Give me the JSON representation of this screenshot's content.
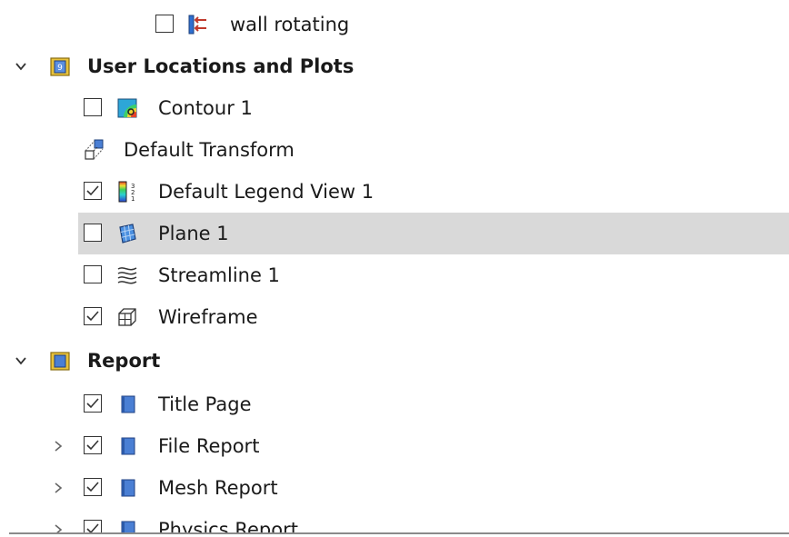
{
  "tree": {
    "rows": [
      {
        "label": "wall rotating",
        "checked": false,
        "icon": "wall-rotating-icon"
      },
      {
        "label": "User Locations and Plots",
        "expanded": true,
        "icon": "folder-icon"
      },
      {
        "label": "Contour 1",
        "checked": false,
        "icon": "contour-icon"
      },
      {
        "label": "Default Transform",
        "icon": "transform-icon"
      },
      {
        "label": "Default Legend View 1",
        "checked": true,
        "icon": "legend-icon"
      },
      {
        "label": "Plane 1",
        "checked": false,
        "selected": true,
        "icon": "plane-icon"
      },
      {
        "label": "Streamline 1",
        "checked": false,
        "icon": "streamline-icon"
      },
      {
        "label": "Wireframe",
        "checked": true,
        "icon": "wireframe-icon"
      },
      {
        "label": "Report",
        "expanded": true,
        "icon": "folder-icon"
      },
      {
        "label": "Title Page",
        "checked": true,
        "icon": "report-page-icon"
      },
      {
        "label": "File Report",
        "checked": true,
        "collapsed": true,
        "icon": "report-page-icon"
      },
      {
        "label": "Mesh Report",
        "checked": true,
        "collapsed": true,
        "icon": "report-page-icon"
      },
      {
        "label": "Physics Report",
        "checked": true,
        "collapsed": true,
        "icon": "report-page-icon"
      }
    ]
  },
  "colors": {
    "selection": "#d9d9d9",
    "report_icon_blue": "#4a7fd4",
    "folder_yellow": "#e8c23a",
    "wall_red": "#c0392b"
  }
}
